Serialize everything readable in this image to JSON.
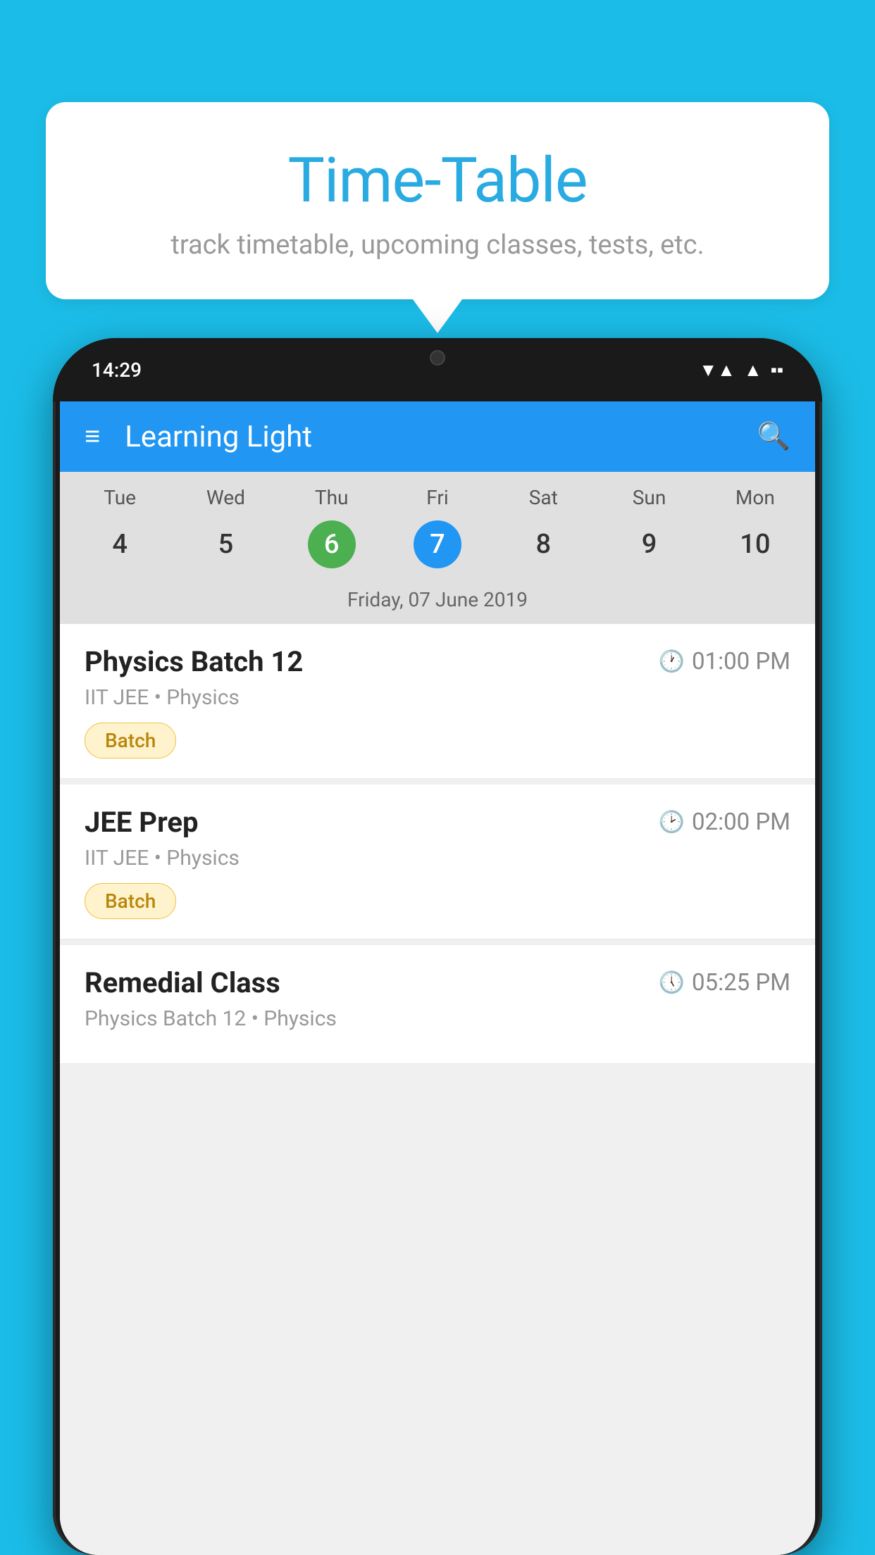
{
  "background": {
    "color": "#1BBDE8"
  },
  "speech_bubble": {
    "title": "Time-Table",
    "subtitle": "track timetable, upcoming classes, tests, etc."
  },
  "phone": {
    "status_bar": {
      "time": "14:29",
      "wifi": "▼▲",
      "signal": "▲",
      "battery": "▪"
    },
    "app_bar": {
      "title": "Learning Light",
      "menu_icon": "≡",
      "search_icon": "🔍"
    },
    "calendar": {
      "days": [
        "Tue",
        "Wed",
        "Thu",
        "Fri",
        "Sat",
        "Sun",
        "Mon"
      ],
      "dates": [
        "4",
        "5",
        "6",
        "7",
        "8",
        "9",
        "10"
      ],
      "today_index": 2,
      "selected_index": 3,
      "selected_date_label": "Friday, 07 June 2019"
    },
    "schedule": [
      {
        "title": "Physics Batch 12",
        "time": "01:00 PM",
        "subtitle": "IIT JEE • Physics",
        "tag": "Batch"
      },
      {
        "title": "JEE Prep",
        "time": "02:00 PM",
        "subtitle": "IIT JEE • Physics",
        "tag": "Batch"
      },
      {
        "title": "Remedial Class",
        "time": "05:25 PM",
        "subtitle": "Physics Batch 12 • Physics",
        "tag": ""
      }
    ]
  }
}
